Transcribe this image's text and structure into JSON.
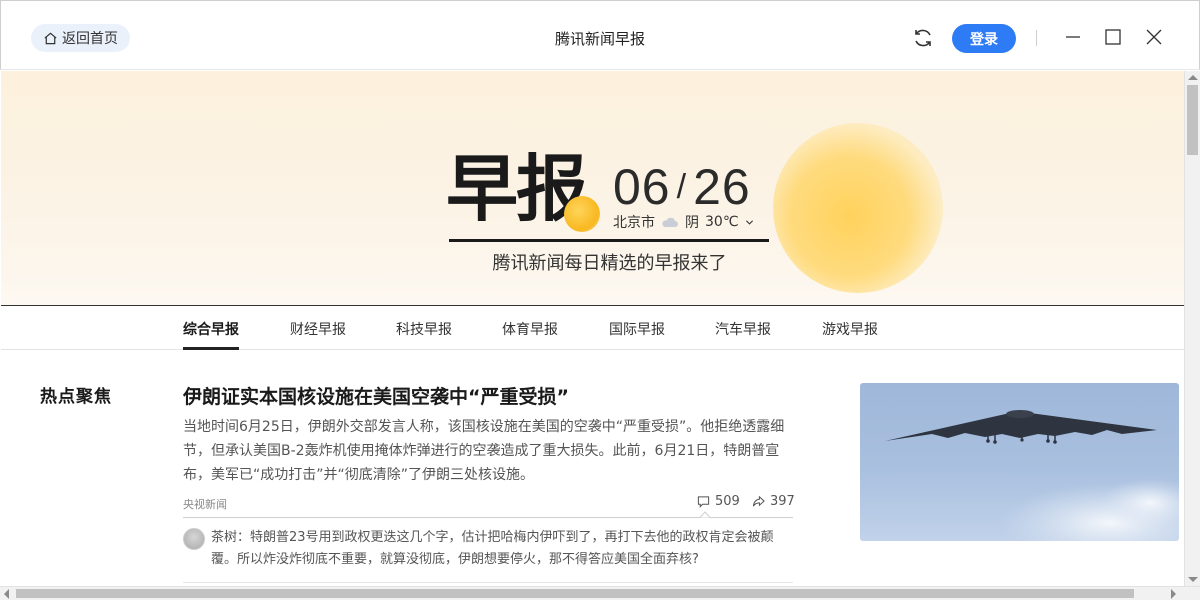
{
  "titlebar": {
    "home_label": "返回首页",
    "window_title": "腾讯新闻早报",
    "login_label": "登录"
  },
  "hero": {
    "logo_text": "早报",
    "month": "06",
    "separator": "/",
    "day": "26",
    "city": "北京市",
    "weather_condition": "阴",
    "temperature": "30℃",
    "tagline": "腾讯新闻每日精选的早报来了"
  },
  "tabs": [
    {
      "label": "综合早报",
      "active": true
    },
    {
      "label": "财经早报",
      "active": false
    },
    {
      "label": "科技早报",
      "active": false
    },
    {
      "label": "体育早报",
      "active": false
    },
    {
      "label": "国际早报",
      "active": false
    },
    {
      "label": "汽车早报",
      "active": false
    },
    {
      "label": "游戏早报",
      "active": false
    }
  ],
  "section": {
    "label": "热点聚焦"
  },
  "article": {
    "title": "伊朗证实本国核设施在美国空袭中“严重受损”",
    "body": "当地时间6月25日，伊朗外交部发言人称，该国核设施在美国的空袭中“严重受损”。他拒绝透露细节，但承认美国B-2轰炸机使用掩体炸弹进行的空袭造成了重大损失。此前，6月21日，特朗普宣布，美军已“成功打击”并“彻底清除”了伊朗三处核设施。",
    "source": "央视新闻",
    "comments": "509",
    "shares": "397",
    "top_comment": "茶树：特朗普23号用到政权更迭这几个字，估计把哈梅内伊吓到了，再打下去他的政权肯定会被颠覆。所以炸没炸彻底不重要，就算没彻底，伊朗想要停火，那不得答应美国全面弃核?"
  },
  "colors": {
    "accent_blue": "#2d7cf6",
    "highlight_yellow": "#ffcd2e",
    "sun_yellow": "#ffd25c"
  }
}
